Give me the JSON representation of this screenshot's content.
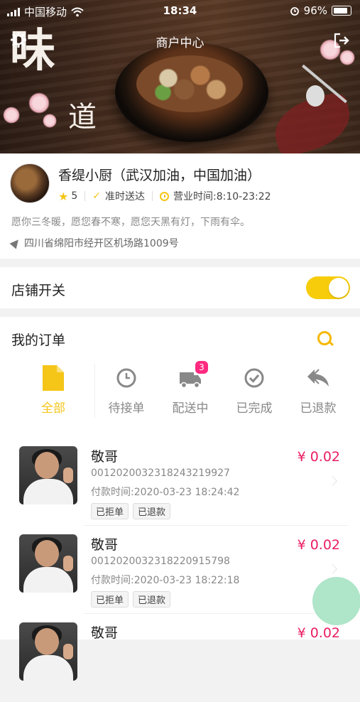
{
  "status_bar": {
    "carrier": "中国移动",
    "time": "18:34",
    "battery": "96%"
  },
  "header": {
    "title": "商户中心",
    "banner_char_1": "味",
    "banner_char_2": "道"
  },
  "shop": {
    "name": "香缇小厨（武汉加油，中国加油）",
    "rating": "5",
    "delivery": "准时送达",
    "hours": "营业时间:8:10-23:22",
    "slogan": "愿你三冬暖，愿您春不寒，愿您天黑有灯，下雨有伞。",
    "address": "四川省绵阳市经开区机场路1009号"
  },
  "store_switch": {
    "label": "店铺开关",
    "on": true
  },
  "orders": {
    "title": "我的订单",
    "tabs": [
      {
        "label": "全部",
        "icon": "document-icon",
        "active": true
      },
      {
        "label": "待接单",
        "icon": "clock-icon"
      },
      {
        "label": "配送中",
        "icon": "truck-icon",
        "badge": "3"
      },
      {
        "label": "已完成",
        "icon": "check-circle-icon"
      },
      {
        "label": "已退款",
        "icon": "reply-icon"
      }
    ],
    "list": [
      {
        "name": "敬哥",
        "order_no": "0012020032318243219927",
        "pay_time": "付款时间:2020-03-23 18:24:42",
        "tags": [
          "已拒单",
          "已退款"
        ],
        "price": "¥ 0.02"
      },
      {
        "name": "敬哥",
        "order_no": "0012020032318220915798",
        "pay_time": "付款时间:2020-03-23 18:22:18",
        "tags": [
          "已拒单",
          "已退款"
        ],
        "price": "¥ 0.02"
      },
      {
        "name": "敬哥",
        "price": "¥ 0.02"
      }
    ]
  },
  "colors": {
    "accent": "#f5c518",
    "price": "#e91e63",
    "badge": "#ff2a7f",
    "fab": "#a6e2c3"
  }
}
